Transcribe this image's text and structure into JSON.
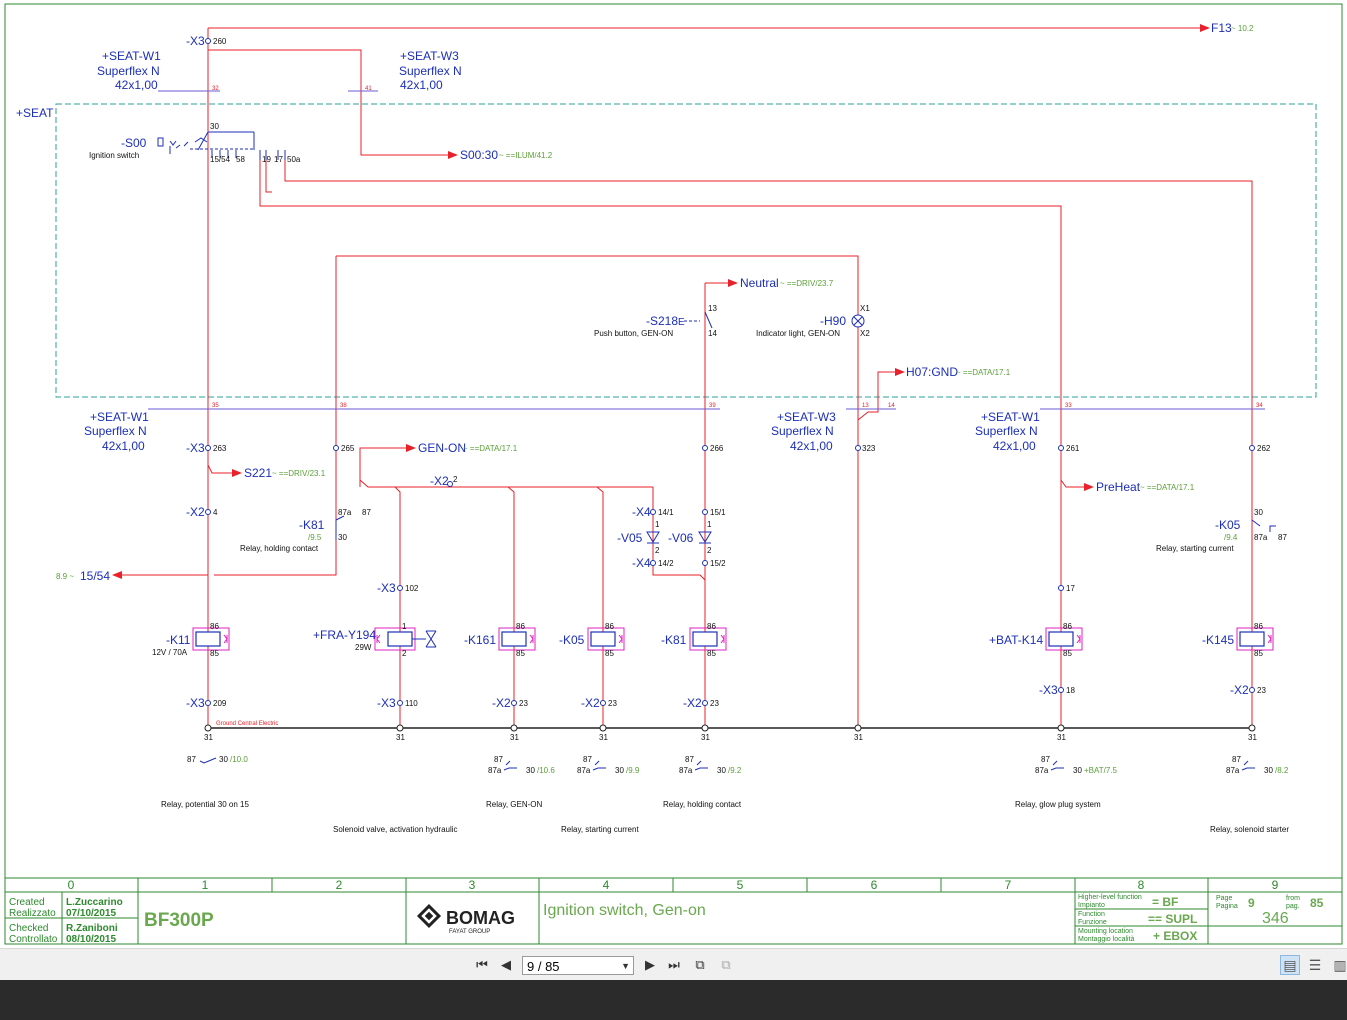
{
  "project": "BF300P",
  "brand": {
    "name": "BOMAG",
    "sub": "FAYAT GROUP"
  },
  "sheet_title": "Ignition switch, Gen-on",
  "title_block": {
    "created_label": "Created",
    "created_label_it": "Realizzato",
    "created_by": "L.Zuccarino",
    "created_date": "07/10/2015",
    "checked_label": "Checked",
    "checked_label_it": "Controllato",
    "checked_by": "R.Zaniboni",
    "checked_date": "08/10/2015",
    "hlf_label": "Higher-level function",
    "hlf_label_it": "Impianto",
    "hlf_value": "= BF",
    "function_label": "Function",
    "function_label_it": "Funzione",
    "function_value": "== SUPL",
    "mount_label": "Mounting location",
    "mount_label_it": "Montaggio località",
    "mount_value": "+ EBOX",
    "page_label": "Page",
    "page_label_it": "Pagina",
    "page_value": "9",
    "from_label": "from",
    "from_label_it": "pag.",
    "from_value": "85",
    "doc_number": "346"
  },
  "columns": [
    "0",
    "1",
    "2",
    "3",
    "4",
    "5",
    "6",
    "7",
    "8",
    "9"
  ],
  "nav": {
    "page_field": "9 / 85"
  },
  "labels": {
    "f13": "F13",
    "f13_ref": "~ 10.2",
    "x3_260": "-X3",
    "n260": "260",
    "seat_w1_top": "+SEAT-W1",
    "superflex_a": "Superflex N",
    "cable_a": "42x1,00",
    "seat_w3_top": "+SEAT-W3",
    "superflex_b": "Superflex N",
    "cable_b": "42x1,00",
    "c32": "32",
    "c41": "41",
    "seat": "+SEAT",
    "s00": "-S00",
    "ign_switch": "Ignition switch",
    "s00_30": "30",
    "s00_1554": "15/54",
    "s00_58": "58",
    "s00_19": "19",
    "s00_17": "17",
    "s00_50a": "50a",
    "s00_30_out": "S00:30",
    "s00_30_ref": "~ ==ILUM/41.2",
    "neutral": "Neutral",
    "neutral_ref": "~ ==DRIV/23.7",
    "s218": "-S218",
    "s218_desc": "Push button, GEN-ON",
    "s218_13": "13",
    "s218_14": "14",
    "h90": "-H90",
    "h90_desc": "Indicator light, GEN-ON",
    "h90_x1": "X1",
    "h90_x2": "X2",
    "h07": "H07:GND",
    "h07_ref": "~ ==DATA/17.1",
    "c35": "35",
    "c38": "38",
    "c39": "39",
    "c13": "13",
    "c14": "14",
    "c33": "33",
    "c34": "34",
    "seat_w1_b": "+SEAT-W1",
    "superflex_c": "Superflex N",
    "cable_c": "42x1,00",
    "seat_w3_b": "+SEAT-W3",
    "superflex_d": "Superflex N",
    "cable_d": "42x1,00",
    "seat_w1_c": "+SEAT-W1",
    "superflex_e": "Superflex N",
    "cable_e": "42x1,00",
    "x3_263": "-X3",
    "n263": "263",
    "n265": "265",
    "n266": "266",
    "n323": "323",
    "n261": "261",
    "n262": "262",
    "gen_on": "GEN-ON",
    "gen_on_ref": "~ ==DATA/17.1",
    "s221": "S221",
    "s221_ref": "~ ==DRIV/23.1",
    "x2_2": "-X2",
    "n2": "2",
    "preheat": "PreHeat",
    "preheat_ref": "~ ==DATA/17.1",
    "x2_4": "-X2",
    "n4": "4",
    "k81a": "-K81",
    "k81a_ref": "/9.5",
    "k81a_desc": "Relay, holding contact",
    "k81a_87a": "87a",
    "k81a_87": "87",
    "k81a_30": "30",
    "x4a": "-X4",
    "n141": "14/1",
    "n151": "15/1",
    "v05": "-V05",
    "v06": "-V06",
    "d1a": "1",
    "d2a": "2",
    "d1b": "1",
    "d2b": "2",
    "x4b": "-X4",
    "n142": "14/2",
    "n152": "15/2",
    "k05a": "-K05",
    "k05a_ref": "/9.4",
    "k05a_desc": "Relay, starting current",
    "k05a_30": "30",
    "k05a_87a": "87a",
    "k05a_87": "87",
    "out1554_ref": "8.9 ~",
    "out1554": "15/54",
    "x3_102": "-X3",
    "n102": "102",
    "n17": "17",
    "k11": "-K11",
    "k11_spec": "12V / 70A",
    "fra": "+FRA-Y194",
    "fra_spec": "29W",
    "fra_1": "1",
    "fra_2": "2",
    "k161": "-K161",
    "k05b": "-K05",
    "k81b": "-K81",
    "bat_k14": "+BAT-K14",
    "k145": "-K145",
    "c86": "86",
    "c85": "85",
    "x3_209": "-X3",
    "n209": "209",
    "x3_110": "-X3",
    "n110": "110",
    "x2_23": "-X2",
    "n23": "23",
    "x3_18": "-X3",
    "n18": "18",
    "gce": "Ground Central Electric",
    "n31": "31",
    "c87": "87",
    "c87a": "87a",
    "c30": "30",
    "r100": "/10.0",
    "r106": "/10.6",
    "r99": "/9.9",
    "r92": "/9.2",
    "r75": "+BAT/7.5",
    "r82": "/8.2",
    "desc_k11": "Relay, potential 30 on 15",
    "desc_fra": "Solenoid valve, activation hydraulic",
    "desc_k161": "Relay, GEN-ON",
    "desc_k05": "Relay, starting current",
    "desc_k81": "Relay, holding contact",
    "desc_k14": "Relay, glow plug system",
    "desc_k145": "Relay, solenoid starter"
  },
  "colors": {
    "wire": "#e8212a",
    "component": "#1c2fb8",
    "border": "#2aa198",
    "bus": "#6b5bd6",
    "coil_mark": "#e020c0",
    "reference": "#5aa038",
    "frame": "#2d8a2d",
    "title_green": "#6aa84f"
  }
}
